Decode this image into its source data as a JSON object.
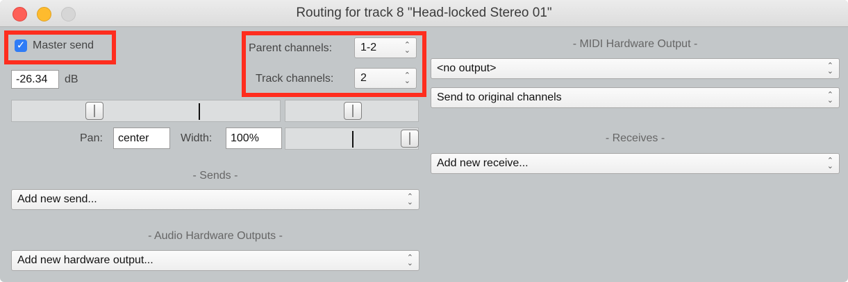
{
  "window": {
    "title": "Routing for track 8 \"Head-locked Stereo 01\""
  },
  "master": {
    "send_label": "Master send",
    "checked": true,
    "volume_value": "-26.34",
    "volume_unit": "dB"
  },
  "channels": {
    "parent_label": "Parent channels:",
    "parent_value": "1-2",
    "track_label": "Track channels:",
    "track_value": "2"
  },
  "pan": {
    "pan_label": "Pan:",
    "pan_value": "center",
    "width_label": "Width:",
    "width_value": "100%"
  },
  "sends": {
    "header": "- Sends -",
    "dropdown": "Add new send..."
  },
  "audio_hw": {
    "header": "- Audio Hardware Outputs -",
    "dropdown": "Add new hardware output..."
  },
  "midi_hw": {
    "header": "- MIDI Hardware Output -",
    "output_dropdown": "<no output>",
    "channel_dropdown": "Send to original channels"
  },
  "receives": {
    "header": "- Receives -",
    "dropdown": "Add new receive..."
  },
  "icons": {
    "checkbox": "checkmark-icon",
    "dropdown": "chevron-updown-icon"
  },
  "colors": {
    "highlight": "#ff2d1e",
    "checkbox_accent": "#2f7cf6",
    "window_bg": "#c3c7c9"
  }
}
